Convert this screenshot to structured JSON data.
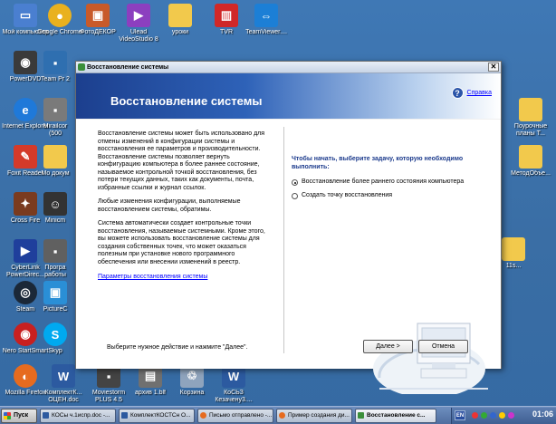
{
  "desktop_icons": [
    {
      "label": "Мой компьютер",
      "color": "#4a7fd0"
    },
    {
      "label": "Google Chrome",
      "color": "#e9b11f"
    },
    {
      "label": "ФотоДЕКОР",
      "color": "#c85a2a"
    },
    {
      "label": "Ulead VideoStudio 8",
      "color": "#8c3fbf"
    },
    {
      "label": "уроки",
      "color": "#f2c94c"
    },
    {
      "label": "TVR",
      "color": "#d02828"
    },
    {
      "label": "TeamViewer....",
      "color": "#1c7fd6"
    },
    {
      "label": "PowerDVD",
      "color": "#3a3a3a"
    },
    {
      "label": "Team Pr 2",
      "color": "#2f6fb0"
    },
    {
      "label": "Internet Explorer",
      "color": "#1f79d9"
    },
    {
      "label": "Mirailcor (500",
      "color": "#7a7a7a"
    },
    {
      "label": "Foxit Reader",
      "color": "#d43a2a"
    },
    {
      "label": "Мо докум",
      "color": "#f2c94c"
    },
    {
      "label": "Cross Fire",
      "color": "#7a3b1f"
    },
    {
      "label": "Minicm",
      "color": "#333333"
    },
    {
      "label": "CyberLink PowerDirec...",
      "color": "#1f3f9c"
    },
    {
      "label": "Програ работы",
      "color": "#606060"
    },
    {
      "label": "Steam",
      "color": "#1b2838"
    },
    {
      "label": "PictureC",
      "color": "#2a8fd6"
    },
    {
      "label": "Nero StartSmart",
      "color": "#c82020"
    },
    {
      "label": "Skyp",
      "color": "#00a9f0"
    },
    {
      "label": "Mozilla Firefox",
      "color": "#e66b1f"
    },
    {
      "label": "КомплектК... ОЦЕН.doc",
      "color": "#2c5aa0"
    },
    {
      "label": "Moviestorm PLUS 4.5",
      "color": "#444444"
    },
    {
      "label": "архив 1.blf",
      "color": "#707070"
    },
    {
      "label": "Корзина",
      "color": "#8fa4bd"
    },
    {
      "label": "КоСЬЗ Кезачену3....",
      "color": "#2c5aa0"
    },
    {
      "label": "Поурочные планы Т...",
      "color": "#f2c94c"
    },
    {
      "label": "МетодОбъе...",
      "color": "#f2c94c"
    },
    {
      "label": "11s...",
      "color": "#f2c94c"
    }
  ],
  "dialog": {
    "title": "Восстановление системы",
    "header_title": "Восстановление системы",
    "help_link": "Справка",
    "left_paragraphs": [
      "Восстановление системы может быть использовано для отмены изменений в конфигурации системы и восстановления ее параметров и производительности. Восстановление системы позволяет вернуть конфигурацию компьютера в более раннее состояние, называемое контрольной точкой восстановления, без потери текущих данных, таких как документы, почта, избранные ссылки и журнал ссылок.",
      "Любые изменения конфигурации, выполняемые восстановлением системы, обратимы.",
      "Система автоматически создает контрольные точки восстановления, называемые системными. Кроме этого, вы можете использовать восстановление системы для создания собственных точек, что может оказаться полезным при установке нового программного обеспечения или внесении изменений в реестр."
    ],
    "settings_link": "Параметры восстановления системы",
    "prompt": "Чтобы начать, выберите задачу, которую необходимо выполнить:",
    "options": [
      {
        "label": "Восстановление более раннего состояния компьютера",
        "checked": true
      },
      {
        "label": "Создать точку восстановления",
        "checked": false
      }
    ],
    "footer_text": "Выберите нужное действие и нажмите \"Далее\".",
    "next_button": "Далее >",
    "cancel_button": "Отмена"
  },
  "taskbar": {
    "start_label": "Пуск",
    "tasks": [
      {
        "label": "КОСы ч.1испр.doc -...",
        "color": "#2c5aa0",
        "active": false
      },
      {
        "label": "КомплектКОСТСн О...",
        "color": "#2c5aa0",
        "active": false
      },
      {
        "label": "Письмо отправлено -...",
        "color": "#e66b1f",
        "active": false
      },
      {
        "label": "Пример создания ди...",
        "color": "#e66b1f",
        "active": false
      },
      {
        "label": "Восстановление с...",
        "color": "#3b8f3b",
        "active": true
      }
    ],
    "lang": "EN",
    "clock": "01:06"
  }
}
